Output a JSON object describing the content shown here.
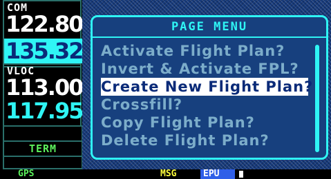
{
  "com": {
    "label": "COM",
    "active": "122.800",
    "standby": "135.325"
  },
  "vloc": {
    "label": "VLOC",
    "active": "113.00",
    "standby": "117.95"
  },
  "cdi": {
    "term_label": "TERM"
  },
  "menu": {
    "title": "PAGE MENU",
    "items": [
      {
        "label": "Activate Flight Plan?"
      },
      {
        "label": "Invert & Activate FPL?"
      },
      {
        "label": "Create New Flight Plan?"
      },
      {
        "label": "Crossfill?"
      },
      {
        "label": "Copy Flight Plan?"
      },
      {
        "label": "Delete Flight Plan?"
      }
    ],
    "selected_index": 2
  },
  "status_bar": {
    "mode": "GPS",
    "msg": "MSG",
    "epu": "EPU"
  },
  "colors": {
    "cyan": "#2ff5f5",
    "green": "#5cf25c",
    "yellow": "#ffff3c",
    "menu_bg": "#17407e"
  }
}
